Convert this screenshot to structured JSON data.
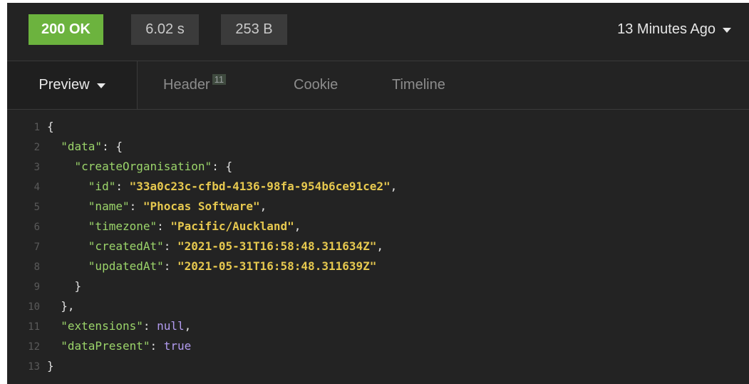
{
  "status_bar": {
    "status": "200 OK",
    "time": "6.02 s",
    "size": "253 B",
    "history": "13 Minutes Ago"
  },
  "tabs": {
    "preview": "Preview",
    "header": "Header",
    "header_count": "11",
    "cookie": "Cookie",
    "timeline": "Timeline"
  },
  "code": {
    "line_numbers": [
      "1",
      "2",
      "3",
      "4",
      "5",
      "6",
      "7",
      "8",
      "9",
      "10",
      "11",
      "12",
      "13"
    ],
    "keys": {
      "data": "\"data\"",
      "createOrganisation": "\"createOrganisation\"",
      "id": "\"id\"",
      "name": "\"name\"",
      "timezone": "\"timezone\"",
      "createdAt": "\"createdAt\"",
      "updatedAt": "\"updatedAt\"",
      "extensions": "\"extensions\"",
      "dataPresent": "\"dataPresent\""
    },
    "values": {
      "id": "\"33a0c23c-cfbd-4136-98fa-954b6ce91ce2\"",
      "name": "\"Phocas Software\"",
      "timezone": "\"Pacific/Auckland\"",
      "createdAt": "\"2021-05-31T16:58:48.311634Z\"",
      "updatedAt": "\"2021-05-31T16:58:48.311639Z\"",
      "extensions": "null",
      "dataPresent": "true"
    }
  },
  "colors": {
    "status_ok": "#6cb33e",
    "json_key": "#9bd46a",
    "json_string": "#e6c84f",
    "json_literal": "#b39cf0"
  }
}
